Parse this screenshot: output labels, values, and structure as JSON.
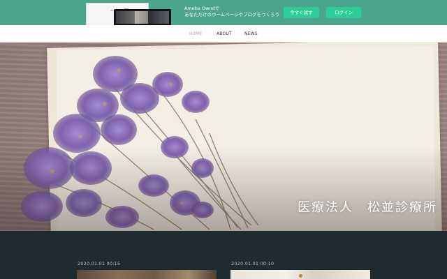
{
  "promo": {
    "line1": "Ameba Owndで",
    "line2": "あなただけのホームページやブログをつくろう",
    "try_label": "今すぐ試す",
    "login_label": "ログイン"
  },
  "nav": {
    "home": "HOME",
    "about": "ABOUT",
    "news": "NEWS"
  },
  "hero": {
    "title": "医療法人　松並診療所"
  },
  "posts": [
    {
      "date": "2020.01.01 00:15"
    },
    {
      "date": "2020.01.01 00:10"
    }
  ],
  "colors": {
    "promo_bg": "#4aa58c",
    "button_green": "#2fcc98",
    "section_bg": "#1f2b2e",
    "flower": "#8a6fb3"
  }
}
